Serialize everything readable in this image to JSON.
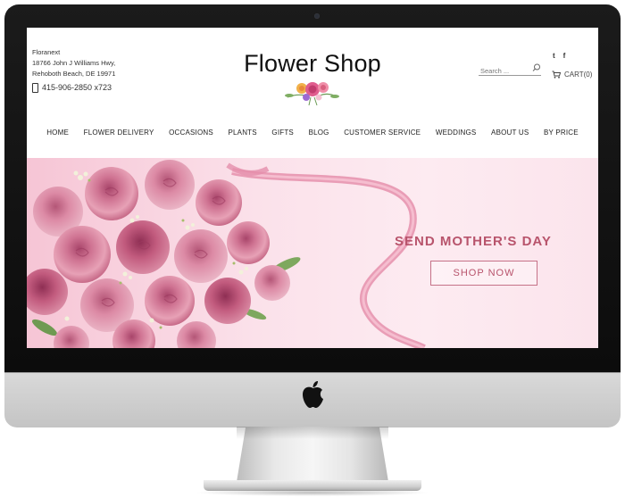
{
  "header": {
    "contact": {
      "name": "Floranext",
      "address_line1": "18766 John J Williams Hwy,",
      "address_line2": "Rehoboth Beach, DE 19971",
      "phone": "415-906-2850 x723"
    },
    "brand_title": "Flower Shop",
    "search": {
      "placeholder": "Search ...",
      "value": ""
    },
    "social": {
      "twitter": "t",
      "facebook": "f"
    },
    "cart_label": "CART(0)"
  },
  "nav": {
    "items": [
      {
        "label": "HOME"
      },
      {
        "label": "FLOWER DELIVERY"
      },
      {
        "label": "OCCASIONS"
      },
      {
        "label": "PLANTS"
      },
      {
        "label": "GIFTS"
      },
      {
        "label": "BLOG"
      },
      {
        "label": "CUSTOMER SERVICE"
      },
      {
        "label": "WEDDINGS"
      },
      {
        "label": "ABOUT US"
      },
      {
        "label": "BY PRICE"
      }
    ]
  },
  "hero": {
    "headline": "SEND MOTHER'S DAY",
    "cta_label": "SHOP NOW",
    "accent_color": "#b8546c"
  },
  "icons": {
    "phone": "phone-icon",
    "search": "search-icon",
    "cart": "cart-icon",
    "twitter": "twitter-icon",
    "facebook": "facebook-icon",
    "apple": "apple-logo-icon"
  }
}
